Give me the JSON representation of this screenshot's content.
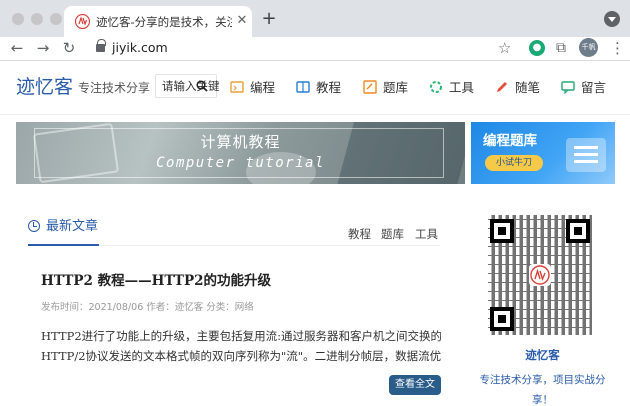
{
  "browser": {
    "tab_title": "迹忆客-分享的是技术，关注的是",
    "tab_close": "✕",
    "new_tab": "+",
    "url": "jiyik.com",
    "profile_label": "千帆",
    "back": "←",
    "forward": "→",
    "reload": "↻",
    "star": "☆",
    "puzzle": "⧉",
    "kebab": "⋮",
    "ext_green": "●"
  },
  "header": {
    "logo": "迹忆客",
    "slogan": "专注技术分享",
    "search_text": "请输入关键"
  },
  "nav": [
    {
      "label": "编程",
      "icon": "code-icon",
      "color": "#e8a13a"
    },
    {
      "label": "教程",
      "icon": "book-icon",
      "color": "#2a7dd1"
    },
    {
      "label": "题库",
      "icon": "quiz-icon",
      "color": "#f08a24"
    },
    {
      "label": "工具",
      "icon": "tool-icon",
      "color": "#2bb673"
    },
    {
      "label": "随笔",
      "icon": "pen-icon",
      "color": "#e74c3c"
    },
    {
      "label": "留言",
      "icon": "message-icon",
      "color": "#27a776"
    }
  ],
  "banner": {
    "title": "计算机教程",
    "subtitle": "Computer tutorial",
    "side_title": "编程题库",
    "side_button": "小试牛刀"
  },
  "section": {
    "title": "最新文章",
    "categories": [
      "教程",
      "题库",
      "工具"
    ]
  },
  "post": {
    "title": "HTTP2 教程——HTTP2的功能升级",
    "meta": "发布时间：2021/08/06 作者：迹忆客 分类：网络",
    "excerpt_line1": "HTTP2进行了功能上的升级，主要包括复用流:通过服务器和客户机之间交换的",
    "excerpt_line2": "HTTP/2协议发送的文本格式帧的双向序列称为\"流\"。二进制分帧层，数据流优先...",
    "read_more": "查看全文"
  },
  "sidebar": {
    "name": "迹忆客",
    "slogan_line1": "专注技术分享，项目实战分",
    "slogan_line2": "享！"
  }
}
